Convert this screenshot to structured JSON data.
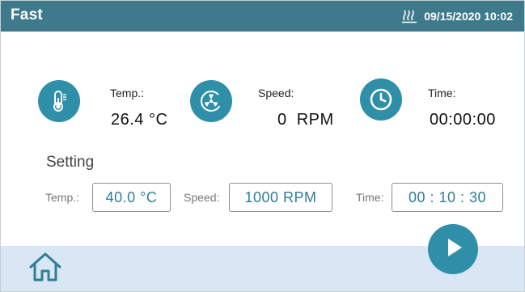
{
  "header": {
    "title": "Fast",
    "datetime": "09/15/2020 10:02",
    "heater_icon": "heater-icon"
  },
  "readouts": {
    "temp": {
      "label": "Temp.:",
      "value": "26.4 °C",
      "icon": "thermometer-icon"
    },
    "speed": {
      "label": "Speed:",
      "value": "0  RPM",
      "icon": "fan-icon"
    },
    "time": {
      "label": "Time:",
      "value": "00:00:00",
      "icon": "clock-icon"
    }
  },
  "setting": {
    "title": "Setting",
    "temp": {
      "label": "Temp.:",
      "value": "40.0 °C"
    },
    "speed": {
      "label": "Speed:",
      "value": "1000 RPM"
    },
    "time": {
      "label": "Time:",
      "value": "00 : 10 : 30"
    }
  },
  "footer": {
    "home_icon": "home-icon",
    "play_icon": "play-icon"
  },
  "colors": {
    "header": "#3f7a8c",
    "accent": "#2f8fa8",
    "footer": "#d9e6f3",
    "setting_value": "#2f7e95"
  }
}
